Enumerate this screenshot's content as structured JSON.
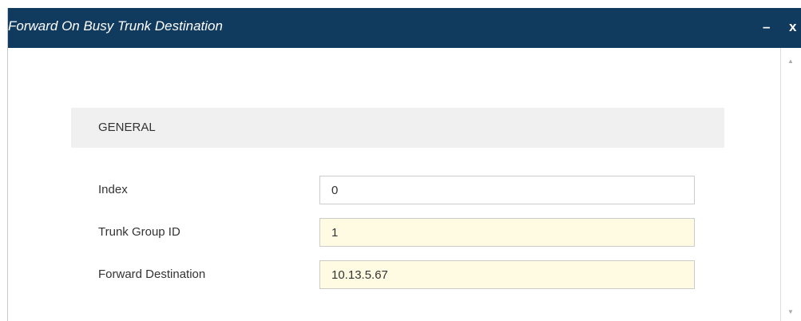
{
  "dialog": {
    "title": "Forward On Busy Trunk Destination",
    "minimize_label": "–",
    "close_label": "x"
  },
  "section": {
    "title": "GENERAL"
  },
  "fields": {
    "index": {
      "label": "Index",
      "value": "0"
    },
    "trunk_group_id": {
      "label": "Trunk Group ID",
      "value": "1"
    },
    "forward_destination": {
      "label": "Forward Destination",
      "value": "10.13.5.67"
    }
  },
  "scrollbar": {
    "up_icon": "▲",
    "down_icon": "▼"
  },
  "colors": {
    "titlebar": "#113a5f",
    "section_bg": "#f0f0f0",
    "modified_field_bg": "#fffbe3"
  }
}
